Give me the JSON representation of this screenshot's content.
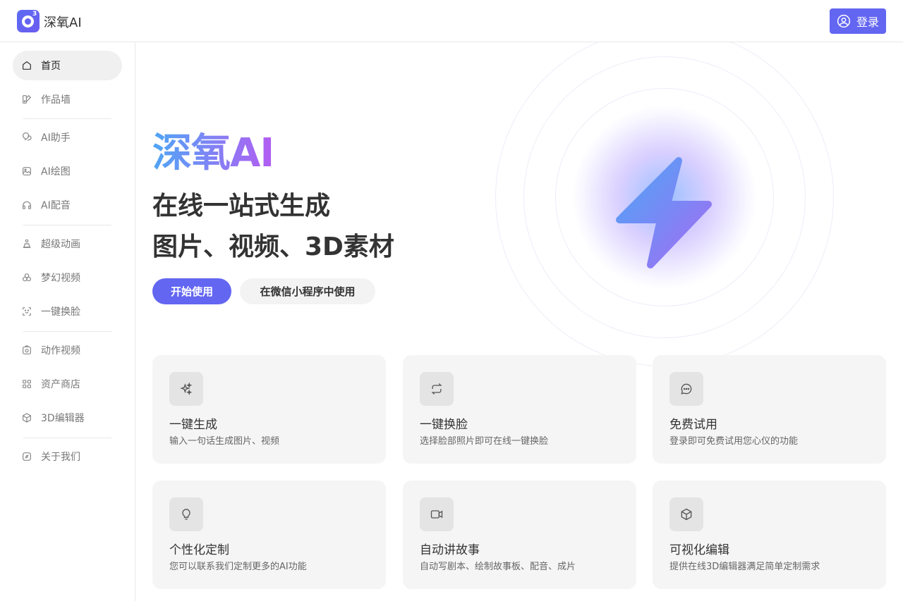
{
  "header": {
    "brand": "深氧AI",
    "logo_sup": "3",
    "login_label": "登录"
  },
  "sidebar": {
    "items": [
      {
        "label": "首页",
        "icon": "home-icon",
        "active": true
      },
      {
        "label": "作品墙",
        "icon": "gallery-icon"
      },
      {
        "label": "AI助手",
        "icon": "chat-bubbles-icon"
      },
      {
        "label": "AI绘图",
        "icon": "image-icon"
      },
      {
        "label": "AI配音",
        "icon": "headphones-icon"
      },
      {
        "label": "超级动画",
        "icon": "animation-icon"
      },
      {
        "label": "梦幻视频",
        "icon": "video-icon"
      },
      {
        "label": "一键换脸",
        "icon": "face-scan-icon"
      },
      {
        "label": "动作视频",
        "icon": "camera-icon"
      },
      {
        "label": "资产商店",
        "icon": "grid-icon"
      },
      {
        "label": "3D编辑器",
        "icon": "cube-icon"
      },
      {
        "label": "关于我们",
        "icon": "compass-icon"
      }
    ]
  },
  "hero": {
    "title": "深氧AI",
    "line1": "在线一站式生成",
    "line2": "图片、视频、3D素材",
    "primary_button": "开始使用",
    "secondary_button": "在微信小程序中使用"
  },
  "features": [
    {
      "title": "一键生成",
      "desc": "输入一句话生成图片、视频",
      "icon": "sparkles-icon"
    },
    {
      "title": "一键换脸",
      "desc": "选择脸部照片即可在线一键换脸",
      "icon": "swap-icon"
    },
    {
      "title": "免费试用",
      "desc": "登录即可免费试用您心仪的功能",
      "icon": "message-icon"
    },
    {
      "title": "个性化定制",
      "desc": "您可以联系我们定制更多的AI功能",
      "icon": "lightbulb-icon"
    },
    {
      "title": "自动讲故事",
      "desc": "自动写剧本、绘制故事板、配音、成片",
      "icon": "video-camera-icon"
    },
    {
      "title": "可视化编辑",
      "desc": "提供在线3D编辑器满足简单定制需求",
      "icon": "box-icon"
    }
  ],
  "colors": {
    "accent": "#6366f1"
  }
}
